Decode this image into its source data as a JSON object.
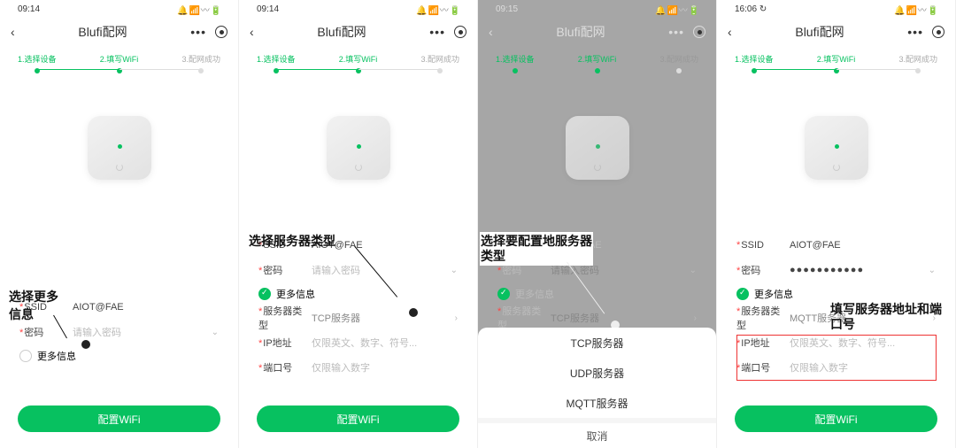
{
  "common": {
    "title": "Blufi配网",
    "steps": [
      "1.选择设备",
      "2.填写WiFi",
      "3.配网成功"
    ],
    "ssid_label": "SSID",
    "ssid_value": "AIOT@FAE",
    "pwd_label": "密码",
    "pwd_placeholder": "请输入密码",
    "more": "更多信息",
    "server_type_label": "服务器类型",
    "ip_label": "IP地址",
    "ip_ph": "仅限英文、数字、符号...",
    "port_label": "端口号",
    "port_ph": "仅限输入数字",
    "btn": "配置WiFi",
    "status_icons": "🔔 📶 〰 🔋",
    "back": "‹"
  },
  "s1": {
    "time": "09:14",
    "anno": "选择更多\n信息"
  },
  "s2": {
    "time": "09:14",
    "server_type_value": "TCP服务器",
    "anno": "选择服务器类型"
  },
  "s3": {
    "time": "09:15",
    "server_type_value": "TCP服务器",
    "anno": "选择要配置地服务器\n类型",
    "sheet": [
      "TCP服务器",
      "UDP服务器",
      "MQTT服务器"
    ],
    "cancel": "取消"
  },
  "s4": {
    "time": "16:06",
    "time_icon": "↻",
    "pwd_value": "●●●●●●●●●●●",
    "server_type_value": "MQTT服务器",
    "anno": "填写服务器地址和端\n口号"
  }
}
